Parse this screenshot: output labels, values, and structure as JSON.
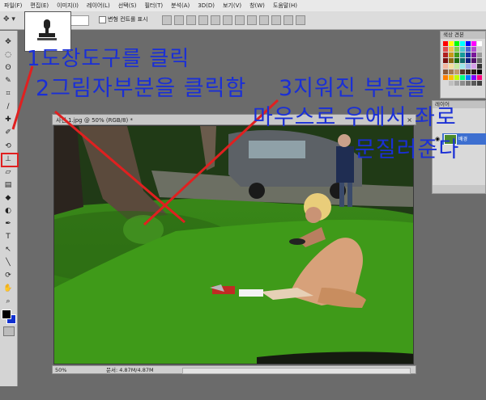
{
  "menubar": {
    "items": [
      "파일(F)",
      "편집(E)",
      "이미지(I)",
      "레이어(L)",
      "선택(S)",
      "필터(T)",
      "분석(A)",
      "3D(D)",
      "보기(V)",
      "창(W)",
      "도움말(H)"
    ]
  },
  "options": {
    "aligned_checkbox_label": "변형 컨트롤 표시"
  },
  "document": {
    "tab_title": "사진 1.jpg @ 50% (RGB/8) *",
    "zoom": "50%",
    "doc_info": "문서: 4.87M/4.87M"
  },
  "panels": {
    "swatches_title": "색상 견본",
    "layers_title": "레이어",
    "layer_name": "배경"
  },
  "annotations": {
    "step1": "1도장도구를 클릭",
    "step2": "2그림자부분을 클릭함",
    "step3_line1": "3지워진 부분을",
    "step3_line2": "마우스로 우에서 좌로",
    "step3_line3": "문질러준다"
  },
  "colors": {
    "annotation_text": "#1a2fd6",
    "annotation_line": "#e02020",
    "highlight_box": "#e02020"
  },
  "icons": [
    "stamp-icon",
    "move-icon",
    "marquee-icon",
    "lasso-icon",
    "crop-icon",
    "eyedropper-icon",
    "brush-icon",
    "eraser-icon",
    "text-icon",
    "hand-icon",
    "zoom-icon",
    "eye-icon"
  ]
}
